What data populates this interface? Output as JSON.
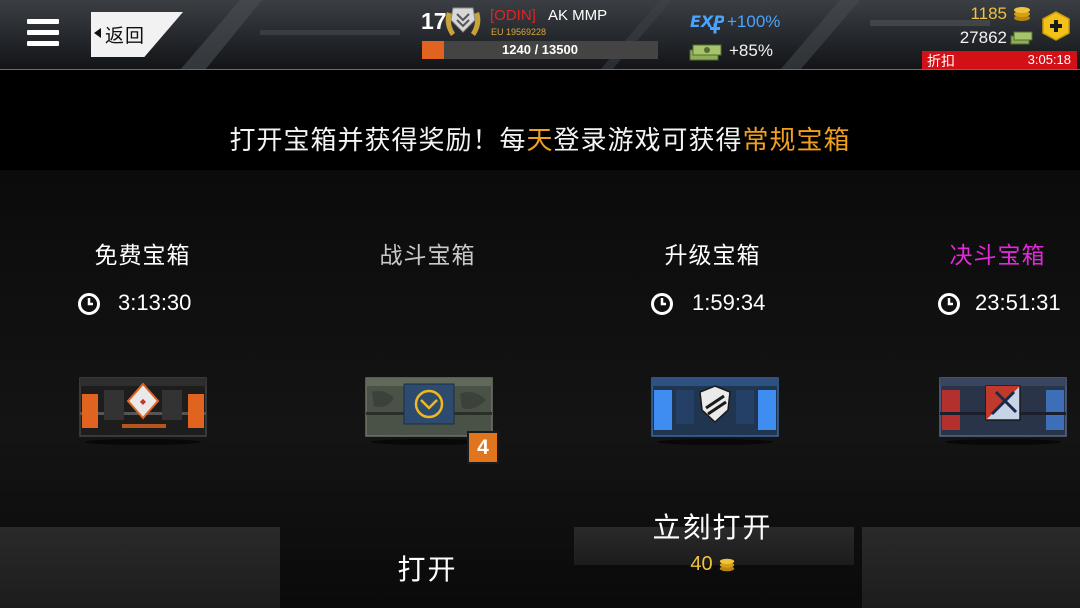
{
  "header": {
    "back_label": "返回",
    "player": {
      "level": "17",
      "clan_tag": "[ODIN]",
      "name": "AK MMP",
      "id": "EU 19569228",
      "xp_text": "1240 / 13500",
      "xp_progress": 0.092
    },
    "bonuses": {
      "exp_label": "EXP",
      "exp_bonus": "+100%",
      "cash_bonus": "+85%"
    },
    "currency": {
      "gold": "1185",
      "cash": "27862"
    },
    "discount": {
      "label": "折扣",
      "timer": "3:05:18"
    }
  },
  "headline": {
    "part1": "打开宝箱并获得奖励！每",
    "part2": "天",
    "part3": "登录游戏可获得",
    "part4": "常规宝箱"
  },
  "chests": [
    {
      "title": "免费宝箱",
      "timer": "3:13:30",
      "title_color": "#ffffff"
    },
    {
      "title": "战斗宝箱",
      "count": "4",
      "open_label": "打开",
      "title_color": "#c9c9c9"
    },
    {
      "title": "升级宝箱",
      "timer": "1:59:34",
      "open_now_label": "立刻打开",
      "price": "40",
      "title_color": "#ffffff"
    },
    {
      "title": "决斗宝箱",
      "timer": "23:51:31",
      "title_color": "#e02ad8"
    }
  ],
  "colors": {
    "accent_orange": "#f0a01e",
    "gold": "#f0c33c",
    "exp_blue": "#4aa3ff",
    "discount_red": "#d31016",
    "duel_magenta": "#e02ad8"
  },
  "icons": [
    "menu-icon",
    "back-arrow-icon",
    "rank-badge-icon",
    "exp-icon",
    "cash-stack-icon",
    "gold-coin-icon",
    "add-icon",
    "clock-icon"
  ]
}
